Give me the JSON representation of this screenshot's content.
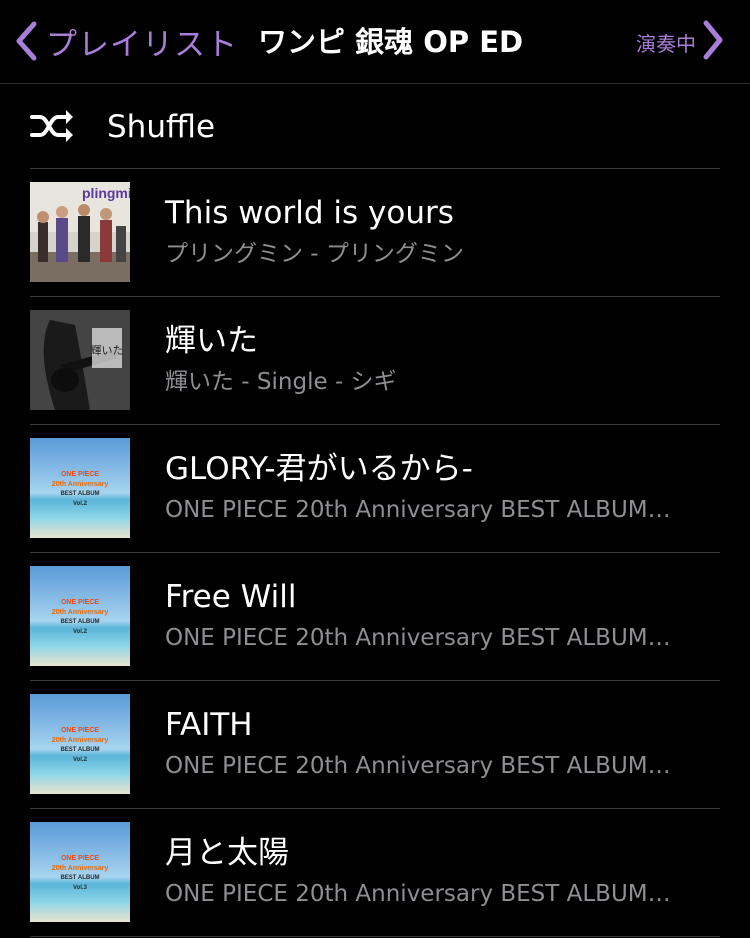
{
  "navbar": {
    "back_label": "プレイリスト",
    "title": "ワンピ 銀魂 OP ED",
    "now_playing_label": "演奏中",
    "accent_color": "#a97ed9"
  },
  "shuffle": {
    "label": "Shuffle",
    "icon": "shuffle-icon"
  },
  "songs": [
    {
      "title": "This world is yours",
      "subtitle": "プリングミン - プリングミン",
      "art": "band-photo",
      "art_text": "plingmin"
    },
    {
      "title": "輝いた",
      "subtitle": "輝いた - Single - シギ",
      "art": "bw-guitar-photo",
      "art_text": "輝いた"
    },
    {
      "title": "GLORY-君がいるから-",
      "subtitle": "ONE PIECE 20th Anniversary BEST ALBUM…",
      "art": "beach-cover",
      "art_text": [
        "ONE PIECE",
        "20th Anniversary",
        "BEST ALBUM",
        "Vol.2"
      ]
    },
    {
      "title": "Free Will",
      "subtitle": "ONE PIECE 20th Anniversary BEST ALBUM…",
      "art": "beach-cover",
      "art_text": [
        "ONE PIECE",
        "20th Anniversary",
        "BEST ALBUM",
        "Vol.2"
      ]
    },
    {
      "title": "FAITH",
      "subtitle": "ONE PIECE 20th Anniversary BEST ALBUM…",
      "art": "beach-cover",
      "art_text": [
        "ONE PIECE",
        "20th Anniversary",
        "BEST ALBUM",
        "Vol.2"
      ]
    },
    {
      "title": "月と太陽",
      "subtitle": "ONE PIECE 20th Anniversary BEST ALBUM…",
      "art": "beach-cover",
      "art_text": [
        "ONE PIECE",
        "20th Anniversary",
        "BEST ALBUM",
        "Vol.3"
      ]
    }
  ]
}
